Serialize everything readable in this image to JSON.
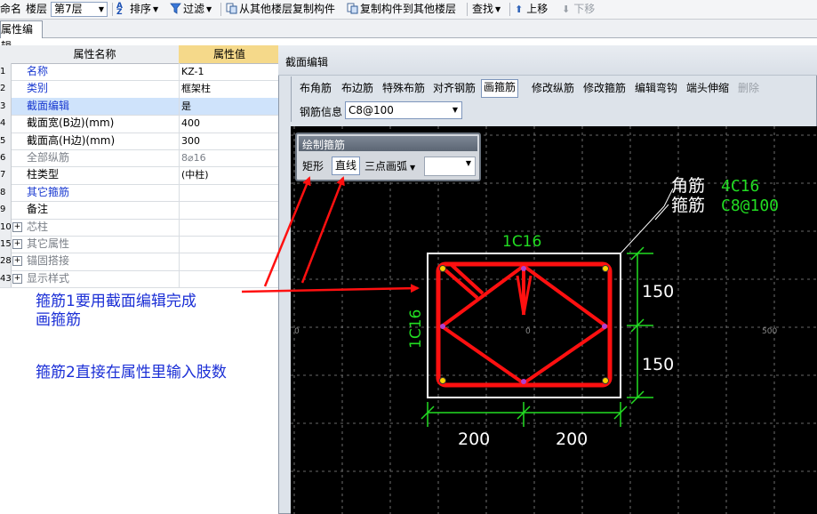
{
  "toolbar": {
    "rename_label": "命名",
    "floor_label": "楼层",
    "floor_value": "第7层",
    "sort_label": "排序",
    "filter_label": "过滤",
    "copy_from_label": "从其他楼层复制构件",
    "copy_to_label": "复制构件到其他楼层",
    "find_label": "查找",
    "move_up_label": "上移",
    "move_down_label": "下移"
  },
  "tabs": {
    "property_edit": "属性编辑"
  },
  "grid": {
    "header_name": "属性名称",
    "header_value": "属性值",
    "rows": [
      {
        "num": "1",
        "name": "名称",
        "value": "KZ-1"
      },
      {
        "num": "2",
        "name": "类别",
        "value": "框架柱"
      },
      {
        "num": "3",
        "name": "截面编辑",
        "value": "是"
      },
      {
        "num": "4",
        "name": "截面宽(B边)(mm)",
        "value": "400"
      },
      {
        "num": "5",
        "name": "截面高(H边)(mm)",
        "value": "300"
      },
      {
        "num": "6",
        "name": "全部纵筋",
        "value": "8⌀16"
      },
      {
        "num": "7",
        "name": "柱类型",
        "value": "(中柱)"
      },
      {
        "num": "8",
        "name": "其它箍筋",
        "value": ""
      },
      {
        "num": "9",
        "name": "备注",
        "value": ""
      },
      {
        "num": "10",
        "name": "芯柱",
        "value": ""
      },
      {
        "num": "15",
        "name": "其它属性",
        "value": ""
      },
      {
        "num": "28",
        "name": "锚固搭接",
        "value": ""
      },
      {
        "num": "43",
        "name": "显示样式",
        "value": ""
      }
    ]
  },
  "notes": {
    "line1": "箍筋1要用截面编辑完成",
    "line2": "画箍筋",
    "line3": "箍筋2直接在属性里输入肢数"
  },
  "editor": {
    "title": "截面编辑",
    "tools": [
      "布角筋",
      "布边筋",
      "特殊布筋",
      "对齐钢筋",
      "画箍筋",
      "修改纵筋",
      "修改箍筋",
      "编辑弯钩",
      "端头伸缩",
      "删除"
    ],
    "rebar_info_label": "钢筋信息",
    "rebar_info_value": "C8@100"
  },
  "draw_panel": {
    "title": "绘制箍筋",
    "rect_label": "矩形",
    "line_label": "直线",
    "arc_label": "三点画弧"
  },
  "canvas": {
    "corner_label": "角筋",
    "corner_value": "4C16",
    "stirrup_label": "箍筋",
    "stirrup_value": "C8@100",
    "top_edge_label": "1C16",
    "side_edge_label": "1C16",
    "dim_h1": "150",
    "dim_h2": "150",
    "dim_w1": "200",
    "dim_w2": "200",
    "axis_0": "0",
    "axis_500": "500"
  },
  "colors": {
    "rebar_red": "#ff1010",
    "dim_green": "#22dd22",
    "annotation_blue": "#1b2fd6",
    "canvas_bg": "#000000"
  }
}
